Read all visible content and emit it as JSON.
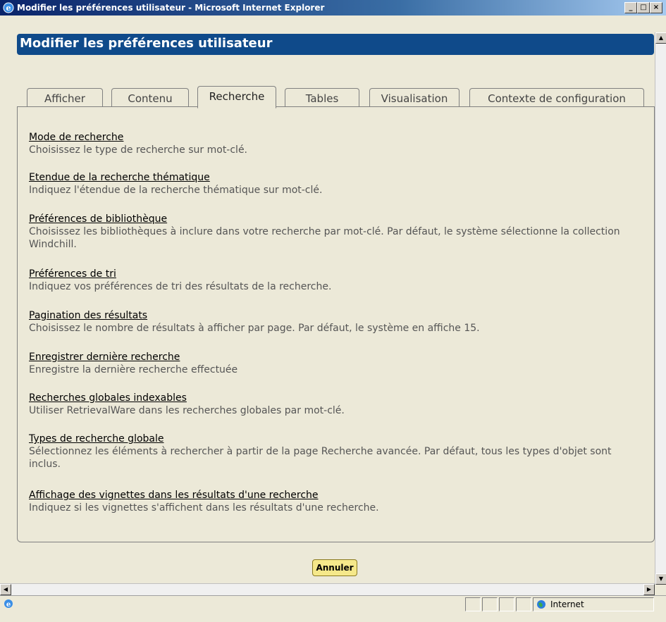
{
  "window": {
    "title": "Modifier les préférences utilisateur - Microsoft Internet Explorer",
    "minimize": "_",
    "maximize": "□",
    "close": "×"
  },
  "page": {
    "heading": "Modifier les préférences utilisateur"
  },
  "tabs": [
    {
      "label": "Afficher",
      "active": false
    },
    {
      "label": "Contenu",
      "active": false
    },
    {
      "label": "Recherche",
      "active": true
    },
    {
      "label": "Tables",
      "active": false
    },
    {
      "label": "Visualisation",
      "active": false
    },
    {
      "label": "Contexte de configuration",
      "active": false
    }
  ],
  "preferences": [
    {
      "title": "Mode de recherche",
      "description": "Choisissez le type de recherche sur mot-clé."
    },
    {
      "title": "Etendue de la recherche thématique",
      "description": "Indiquez l'étendue de la recherche thématique sur mot-clé."
    },
    {
      "title": "Préférences de bibliothèque",
      "description": "Choisissez les bibliothèques à inclure dans votre recherche par mot-clé. Par défaut, le système sélectionne la collection Windchill."
    },
    {
      "title": "Préférences de tri",
      "description": "Indiquez vos préférences de tri des résultats de la recherche."
    },
    {
      "title": "Pagination des résultats",
      "description": "Choisissez le nombre de résultats à afficher par page. Par défaut, le système en affiche 15."
    },
    {
      "title": "Enregistrer dernière recherche",
      "description": "Enregistre la dernière recherche effectuée"
    },
    {
      "title": "Recherches globales indexables",
      "description": "Utiliser RetrievalWare dans les recherches globales par mot-clé."
    },
    {
      "title": "Types de recherche globale",
      "description": "Sélectionnez les éléments à rechercher à partir de la page Recherche avancée. Par défaut, tous les types d'objet sont inclus."
    },
    {
      "title": "Affichage des vignettes dans les résultats d'une recherche",
      "description": "Indiquez si les vignettes s'affichent dans les résultats d'une recherche."
    }
  ],
  "actions": {
    "cancel": "Annuler"
  },
  "status": {
    "zone": "Internet"
  },
  "colors": {
    "heading_bg": "#0f4a8a",
    "cancel_bg": "#f5e88a"
  }
}
